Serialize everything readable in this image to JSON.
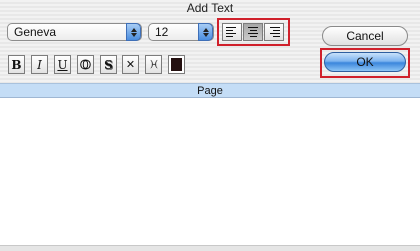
{
  "window": {
    "title": "Add Text"
  },
  "font": {
    "selected": "Geneva"
  },
  "size": {
    "selected": "12"
  },
  "alignment": {
    "options": [
      "left",
      "center",
      "right"
    ],
    "selected": "center"
  },
  "buttons": {
    "cancel": "Cancel",
    "ok": "OK"
  },
  "styles": {
    "bold": "B",
    "italic": "I",
    "underline": "U",
    "outline": "O",
    "shadow": "S",
    "condensed": "✕",
    "extended": ")-(",
    "color": "#241010"
  },
  "page": {
    "header": "Page",
    "content": ""
  },
  "colors": {
    "highlight_frame": "#d0202b",
    "page_header_bg": "#c4ddf6"
  }
}
